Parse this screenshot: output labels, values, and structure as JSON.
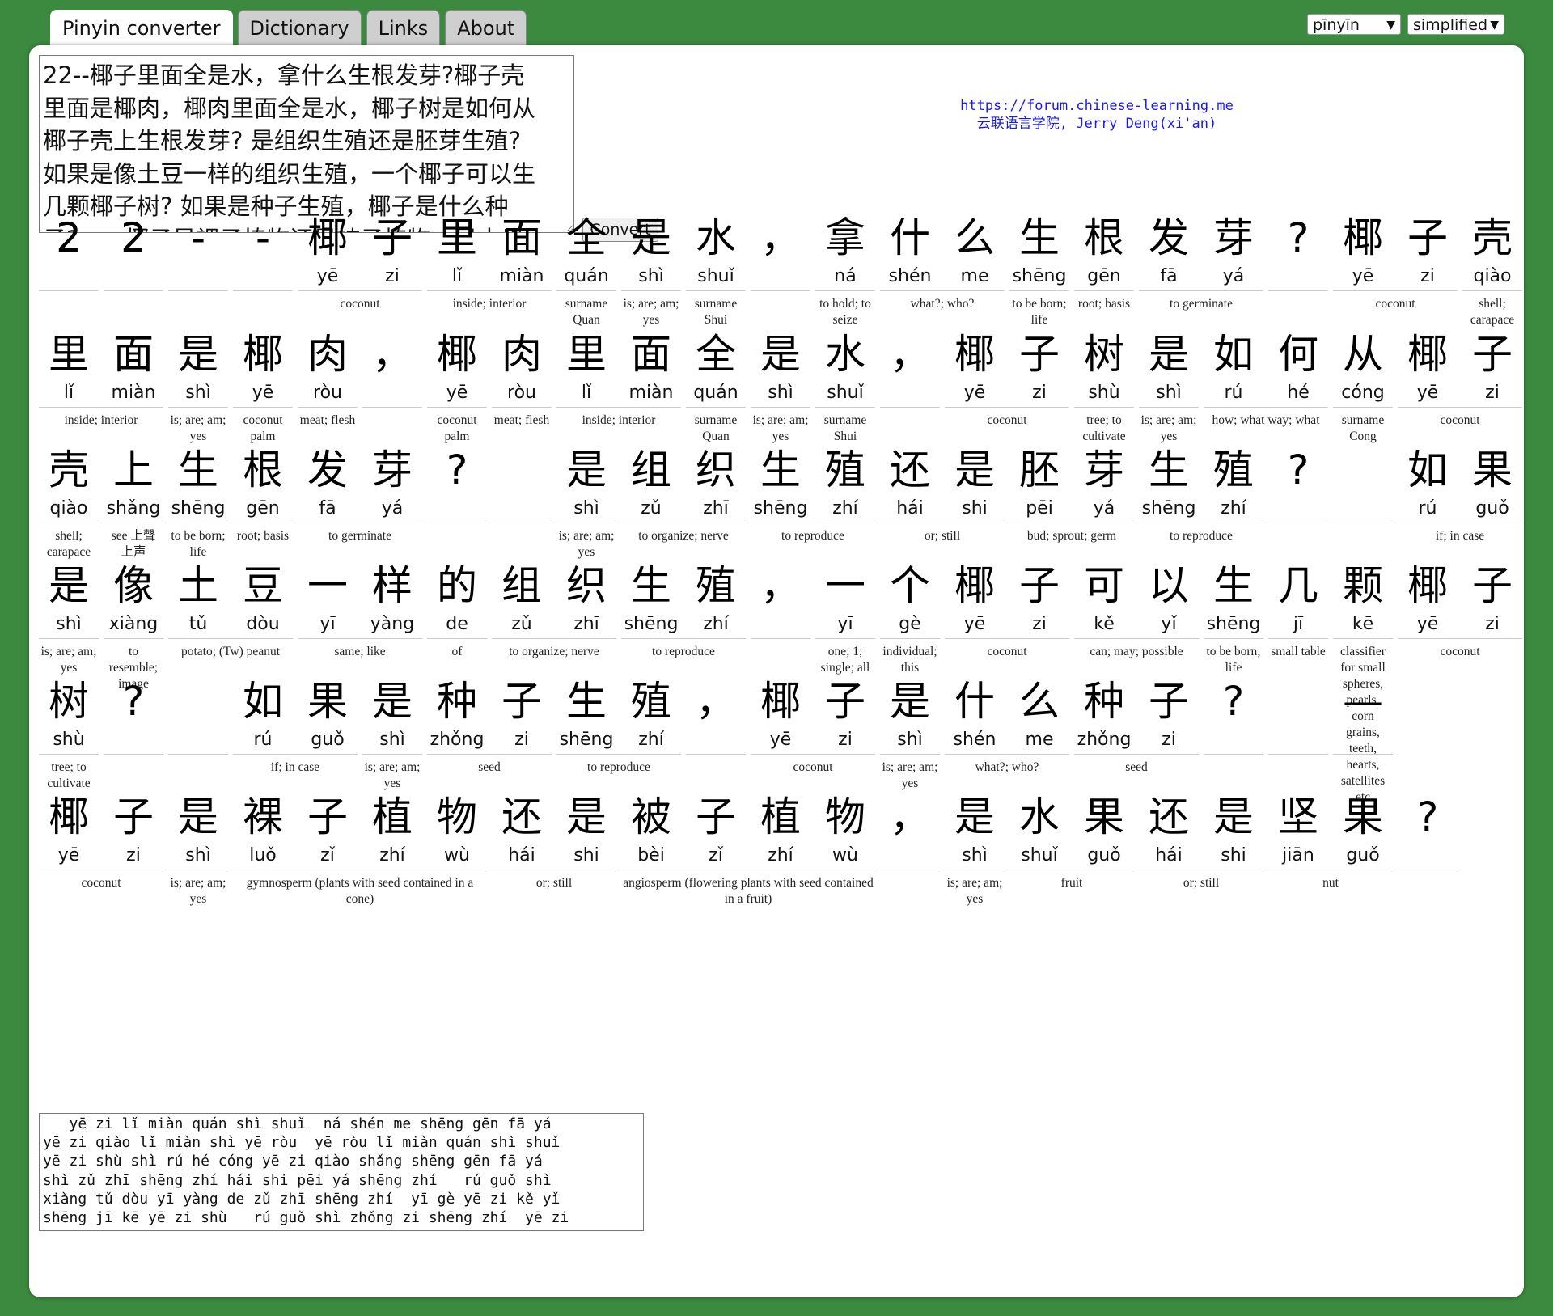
{
  "tabs": [
    "Pinyin converter",
    "Dictionary",
    "Links",
    "About"
  ],
  "selects": {
    "romanization": "pīnyīn",
    "script": "simplified"
  },
  "input": {
    "lines": [
      "22--椰子里面全是水，拿什么生根发芽?椰子壳",
      "里面是椰肉，椰肉里面全是水，椰子树是如何从",
      "椰子壳上生根发芽? 是组织生殖还是胚芽生殖?",
      "如果是像土豆一样的组织生殖，一个椰子可以生",
      "几颗椰子树? 如果是种子生殖，椰子是什么种",
      "子?……椰子是裸子植物还是被子植物，是水果"
    ]
  },
  "convert_label": "Convert",
  "credit": {
    "url": "https://forum.chinese-learning.me",
    "line2": "云联语言学院, Jerry Deng(xi'an)"
  },
  "rows": [
    [
      {
        "c": [
          [
            "2",
            ""
          ]
        ],
        "g": ""
      },
      {
        "c": [
          [
            "2",
            ""
          ]
        ],
        "g": ""
      },
      {
        "c": [
          [
            "-",
            ""
          ]
        ],
        "g": ""
      },
      {
        "c": [
          [
            "-",
            ""
          ]
        ],
        "g": ""
      },
      {
        "c": [
          [
            "椰",
            "yē"
          ],
          [
            "子",
            "zi"
          ]
        ],
        "g": "coconut"
      },
      {
        "c": [
          [
            "里",
            "lǐ"
          ],
          [
            "面",
            "miàn"
          ]
        ],
        "g": "inside; interior"
      },
      {
        "c": [
          [
            "全",
            "quán"
          ]
        ],
        "g": "surname Quan"
      },
      {
        "c": [
          [
            "是",
            "shì"
          ]
        ],
        "g": "is; are; am; yes"
      },
      {
        "c": [
          [
            "水",
            "shuǐ"
          ]
        ],
        "g": "surname Shui"
      },
      {
        "c": [
          [
            "，",
            ""
          ]
        ],
        "g": ""
      },
      {
        "c": [
          [
            "拿",
            "ná"
          ]
        ],
        "g": "to hold; to seize"
      },
      {
        "c": [
          [
            "什",
            "shén"
          ],
          [
            "么",
            "me"
          ]
        ],
        "g": "what?; who?"
      },
      {
        "c": [
          [
            "生",
            "shēng"
          ]
        ],
        "g": "to be born; life"
      },
      {
        "c": [
          [
            "根",
            "gēn"
          ]
        ],
        "g": "root; basis"
      },
      {
        "c": [
          [
            "发",
            "fā"
          ],
          [
            "芽",
            "yá"
          ]
        ],
        "g": "to germinate"
      },
      {
        "c": [
          [
            "?",
            ""
          ]
        ],
        "g": ""
      },
      {
        "c": [
          [
            "椰",
            "yē"
          ],
          [
            "子",
            "zi"
          ]
        ],
        "g": "coconut"
      },
      {
        "c": [
          [
            "壳",
            "qiào"
          ]
        ],
        "g": "shell; carapace"
      }
    ],
    [
      {
        "c": [
          [
            "里",
            "lǐ"
          ],
          [
            "面",
            "miàn"
          ]
        ],
        "g": "inside; interior"
      },
      {
        "c": [
          [
            "是",
            "shì"
          ]
        ],
        "g": "is; are; am; yes"
      },
      {
        "c": [
          [
            "椰",
            "yē"
          ]
        ],
        "g": "coconut palm"
      },
      {
        "c": [
          [
            "肉",
            "ròu"
          ]
        ],
        "g": "meat; flesh"
      },
      {
        "c": [
          [
            "，",
            ""
          ]
        ],
        "g": ""
      },
      {
        "c": [
          [
            "椰",
            "yē"
          ]
        ],
        "g": "coconut palm"
      },
      {
        "c": [
          [
            "肉",
            "ròu"
          ]
        ],
        "g": "meat; flesh"
      },
      {
        "c": [
          [
            "里",
            "lǐ"
          ],
          [
            "面",
            "miàn"
          ]
        ],
        "g": "inside; interior"
      },
      {
        "c": [
          [
            "全",
            "quán"
          ]
        ],
        "g": "surname Quan"
      },
      {
        "c": [
          [
            "是",
            "shì"
          ]
        ],
        "g": "is; are; am; yes"
      },
      {
        "c": [
          [
            "水",
            "shuǐ"
          ]
        ],
        "g": "surname Shui"
      },
      {
        "c": [
          [
            "，",
            ""
          ]
        ],
        "g": ""
      },
      {
        "c": [
          [
            "椰",
            "yē"
          ],
          [
            "子",
            "zi"
          ]
        ],
        "g": "coconut"
      },
      {
        "c": [
          [
            "树",
            "shù"
          ]
        ],
        "g": "tree; to cultivate"
      },
      {
        "c": [
          [
            "是",
            "shì"
          ]
        ],
        "g": "is; are; am; yes"
      },
      {
        "c": [
          [
            "如",
            "rú"
          ],
          [
            "何",
            "hé"
          ]
        ],
        "g": "how; what way; what"
      },
      {
        "c": [
          [
            "从",
            "cóng"
          ]
        ],
        "g": "surname Cong"
      },
      {
        "c": [
          [
            "椰",
            "yē"
          ],
          [
            "子",
            "zi"
          ]
        ],
        "g": "coconut"
      }
    ],
    [
      {
        "c": [
          [
            "壳",
            "qiào"
          ]
        ],
        "g": "shell; carapace"
      },
      {
        "c": [
          [
            "上",
            "shǎng"
          ]
        ],
        "g": "see 上聲 上声"
      },
      {
        "c": [
          [
            "生",
            "shēng"
          ]
        ],
        "g": "to be born; life"
      },
      {
        "c": [
          [
            "根",
            "gēn"
          ]
        ],
        "g": "root; basis"
      },
      {
        "c": [
          [
            "发",
            "fā"
          ],
          [
            "芽",
            "yá"
          ]
        ],
        "g": "to germinate"
      },
      {
        "c": [
          [
            "?",
            ""
          ]
        ],
        "g": ""
      },
      {
        "c": [
          [
            " ",
            ""
          ]
        ],
        "g": ""
      },
      {
        "c": [
          [
            "是",
            "shì"
          ]
        ],
        "g": "is; are; am; yes"
      },
      {
        "c": [
          [
            "组",
            "zǔ"
          ],
          [
            "织",
            "zhī"
          ]
        ],
        "g": "to organize; nerve"
      },
      {
        "c": [
          [
            "生",
            "shēng"
          ],
          [
            "殖",
            "zhí"
          ]
        ],
        "g": "to reproduce"
      },
      {
        "c": [
          [
            "还",
            "hái"
          ],
          [
            "是",
            "shi"
          ]
        ],
        "g": "or; still"
      },
      {
        "c": [
          [
            "胚",
            "pēi"
          ],
          [
            "芽",
            "yá"
          ]
        ],
        "g": "bud; sprout; germ"
      },
      {
        "c": [
          [
            "生",
            "shēng"
          ],
          [
            "殖",
            "zhí"
          ]
        ],
        "g": "to reproduce"
      },
      {
        "c": [
          [
            "?",
            ""
          ]
        ],
        "g": ""
      },
      {
        "c": [
          [
            " ",
            ""
          ]
        ],
        "g": ""
      },
      {
        "c": [
          [
            "如",
            "rú"
          ],
          [
            "果",
            "guǒ"
          ]
        ],
        "g": "if; in case"
      }
    ],
    [
      {
        "c": [
          [
            "是",
            "shì"
          ]
        ],
        "g": "is; are; am; yes"
      },
      {
        "c": [
          [
            "像",
            "xiàng"
          ]
        ],
        "g": "to resemble; image"
      },
      {
        "c": [
          [
            "土",
            "tǔ"
          ],
          [
            "豆",
            "dòu"
          ]
        ],
        "g": "potato; (Tw) peanut"
      },
      {
        "c": [
          [
            "一",
            "yī"
          ],
          [
            "样",
            "yàng"
          ]
        ],
        "g": "same; like"
      },
      {
        "c": [
          [
            "的",
            "de"
          ]
        ],
        "g": "of"
      },
      {
        "c": [
          [
            "组",
            "zǔ"
          ],
          [
            "织",
            "zhī"
          ]
        ],
        "g": "to organize; nerve"
      },
      {
        "c": [
          [
            "生",
            "shēng"
          ],
          [
            "殖",
            "zhí"
          ]
        ],
        "g": "to reproduce"
      },
      {
        "c": [
          [
            "，",
            ""
          ]
        ],
        "g": ""
      },
      {
        "c": [
          [
            "一",
            "yī"
          ]
        ],
        "g": "one; 1; single; all"
      },
      {
        "c": [
          [
            "个",
            "gè"
          ]
        ],
        "g": "individual; this"
      },
      {
        "c": [
          [
            "椰",
            "yē"
          ],
          [
            "子",
            "zi"
          ]
        ],
        "g": "coconut"
      },
      {
        "c": [
          [
            "可",
            "kě"
          ],
          [
            "以",
            "yǐ"
          ]
        ],
        "g": "can; may; possible"
      },
      {
        "c": [
          [
            "生",
            "shēng"
          ]
        ],
        "g": "to be born; life"
      },
      {
        "c": [
          [
            "几",
            "jī"
          ]
        ],
        "g": "small table"
      },
      {
        "c": [
          [
            "颗",
            "kē"
          ]
        ],
        "g": "classifier for small spheres, pearls, corn grains, teeth, hearts, satellites etc"
      },
      {
        "c": [
          [
            "椰",
            "yē"
          ],
          [
            "子",
            "zi"
          ]
        ],
        "g": "coconut"
      }
    ],
    [
      {
        "c": [
          [
            "树",
            "shù"
          ]
        ],
        "g": "tree; to cultivate"
      },
      {
        "c": [
          [
            "?",
            ""
          ]
        ],
        "g": ""
      },
      {
        "c": [
          [
            " ",
            ""
          ]
        ],
        "g": ""
      },
      {
        "c": [
          [
            "如",
            "rú"
          ],
          [
            "果",
            "guǒ"
          ]
        ],
        "g": "if; in case"
      },
      {
        "c": [
          [
            "是",
            "shì"
          ]
        ],
        "g": "is; are; am; yes"
      },
      {
        "c": [
          [
            "种",
            "zhǒng"
          ],
          [
            "子",
            "zi"
          ]
        ],
        "g": "seed"
      },
      {
        "c": [
          [
            "生",
            "shēng"
          ],
          [
            "殖",
            "zhí"
          ]
        ],
        "g": "to reproduce"
      },
      {
        "c": [
          [
            "，",
            ""
          ]
        ],
        "g": ""
      },
      {
        "c": [
          [
            "椰",
            "yē"
          ],
          [
            "子",
            "zi"
          ]
        ],
        "g": "coconut"
      },
      {
        "c": [
          [
            "是",
            "shì"
          ]
        ],
        "g": "is; are; am; yes"
      },
      {
        "c": [
          [
            "什",
            "shén"
          ],
          [
            "么",
            "me"
          ]
        ],
        "g": "what?; who?"
      },
      {
        "c": [
          [
            "种",
            "zhǒng"
          ],
          [
            "子",
            "zi"
          ]
        ],
        "g": "seed"
      },
      {
        "c": [
          [
            "?",
            ""
          ]
        ],
        "g": ""
      },
      {
        "c": [
          [
            " ",
            ""
          ]
        ],
        "g": ""
      },
      {
        "c": [
          [
            "—",
            ""
          ]
        ],
        "g": ""
      }
    ],
    [
      {
        "c": [
          [
            "椰",
            "yē"
          ],
          [
            "子",
            "zi"
          ]
        ],
        "g": "coconut"
      },
      {
        "c": [
          [
            "是",
            "shì"
          ]
        ],
        "g": "is; are; am; yes"
      },
      {
        "c": [
          [
            "裸",
            "luǒ"
          ],
          [
            "子",
            "zǐ"
          ],
          [
            "植",
            "zhí"
          ],
          [
            "物",
            "wù"
          ]
        ],
        "g": "gymnosperm (plants with seed contained in a cone)"
      },
      {
        "c": [
          [
            "还",
            "hái"
          ],
          [
            "是",
            "shi"
          ]
        ],
        "g": "or; still"
      },
      {
        "c": [
          [
            "被",
            "bèi"
          ],
          [
            "子",
            "zǐ"
          ],
          [
            "植",
            "zhí"
          ],
          [
            "物",
            "wù"
          ]
        ],
        "g": "angiosperm (flowering plants with seed contained in a fruit)"
      },
      {
        "c": [
          [
            "，",
            ""
          ]
        ],
        "g": ""
      },
      {
        "c": [
          [
            "是",
            "shì"
          ]
        ],
        "g": "is; are; am; yes"
      },
      {
        "c": [
          [
            "水",
            "shuǐ"
          ],
          [
            "果",
            "guǒ"
          ]
        ],
        "g": "fruit"
      },
      {
        "c": [
          [
            "还",
            "hái"
          ],
          [
            "是",
            "shi"
          ]
        ],
        "g": "or; still"
      },
      {
        "c": [
          [
            "坚",
            "jiān"
          ],
          [
            "果",
            "guǒ"
          ]
        ],
        "g": "nut"
      },
      {
        "c": [
          [
            "?",
            ""
          ]
        ],
        "g": ""
      }
    ]
  ],
  "output": {
    "lines": [
      "   yē zi lǐ miàn quán shì shuǐ  ná shén me shēng gēn fā yá",
      "yē zi qiào lǐ miàn shì yē ròu  yē ròu lǐ miàn quán shì shuǐ",
      "yē zi shù shì rú hé cóng yē zi qiào shǎng shēng gēn fā yá",
      "shì zǔ zhī shēng zhí hái shi pēi yá shēng zhí   rú guǒ shì",
      "xiàng tǔ dòu yī yàng de zǔ zhī shēng zhí  yī gè yē zi kě yǐ",
      "shēng jī kē yē zi shù   rú guǒ shì zhǒng zi shēng zhí  yē zi"
    ]
  }
}
